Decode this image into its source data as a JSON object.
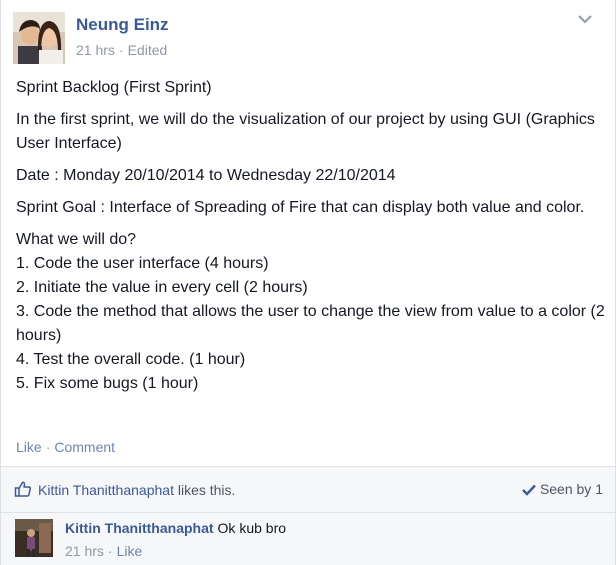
{
  "post": {
    "author": "Neung Einz",
    "time": "21 hrs",
    "separator": "·",
    "edited": "Edited",
    "paragraphs": [
      "Sprint Backlog (First Sprint)",
      "In the first sprint, we will do the visualization of our project by using GUI (Graphics User Interface)",
      "Date : Monday 20/10/2014 to Wednesday 22/10/2014",
      "Sprint Goal : Interface of Spreading of Fire that can display both value and color."
    ],
    "todo_heading": "What we will do?",
    "todo_items": [
      "1. Code the user interface (4 hours)",
      "2. Initiate the value in every cell (2 hours)",
      "3. Code the method that allows the user to change the view from value to a color (2 hours)",
      "4. Test the overall code. (1 hour)",
      "5. Fix some bugs (1 hour)"
    ]
  },
  "actions": {
    "like": "Like",
    "separator": "·",
    "comment": "Comment"
  },
  "likes": {
    "name": "Kittin Thanitthanaphat",
    "suffix": " likes this.",
    "seen_by": "Seen by 1"
  },
  "comment": {
    "author": "Kittin Thanitthanaphat",
    "text": "Ok kub bro",
    "time": "21 hrs",
    "separator": "·",
    "like": "Like"
  },
  "colors": {
    "link": "#3b5998",
    "muted": "#9197a3",
    "footer_bg": "#f6f7f8"
  },
  "icons": {
    "options": "chevron-down-icon",
    "like": "thumbs-up-icon",
    "seen": "checkmark-icon"
  }
}
